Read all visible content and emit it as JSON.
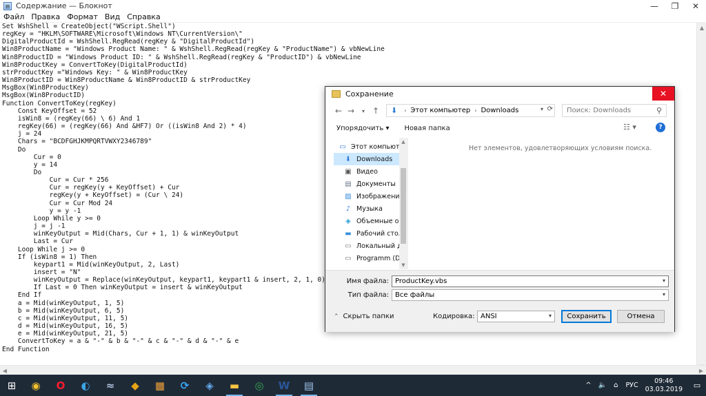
{
  "window": {
    "title": "Содержание — Блокнот",
    "minimize": "—",
    "maximize": "❐",
    "close": "✕"
  },
  "menu": [
    "Файл",
    "Правка",
    "Формат",
    "Вид",
    "Справка"
  ],
  "editor": {
    "lines": [
      "Set WshShell = CreateObject(\"WScript.Shell\")",
      "regKey = \"HKLM\\SOFTWARE\\Microsoft\\Windows NT\\CurrentVersion\\\"",
      "DigitalProductId = WshShell.RegRead(regKey & \"DigitalProductId\")",
      "Win8ProductName = \"Windows Product Name: \" & WshShell.RegRead(regKey & \"ProductName\") & vbNewLine",
      "Win8ProductID = \"Windows Product ID: \" & WshShell.RegRead(regKey & \"ProductID\") & vbNewLine",
      "Win8ProductKey = ConvertToKey(DigitalProductId)",
      "strProductKey =\"Windows Key: \" & Win8ProductKey",
      "Win8ProductID = Win8ProductName & Win8ProductID & strProductKey",
      "MsgBox(Win8ProductKey)",
      "MsgBox(Win8ProductID)",
      "Function ConvertToKey(regKey)",
      "    Const KeyOffset = 52",
      "    isWin8 = (regKey(66) \\ 6) And 1",
      "    regKey(66) = (regKey(66) And &HF7) Or ((isWin8 And 2) * 4)",
      "    j = 24",
      "    Chars = \"BCDFGHJKMPQRTVWXY2346789\"",
      "    Do",
      "        Cur = 0",
      "        y = 14",
      "        Do",
      "            Cur = Cur * 256",
      "            Cur = regKey(y + KeyOffset) + Cur",
      "            regKey(y + KeyOffset) = (Cur \\ 24)",
      "            Cur = Cur Mod 24",
      "            y = y -1",
      "        Loop While y >= 0",
      "        j = j -1",
      "        winKeyOutput = Mid(Chars, Cur + 1, 1) & winKeyOutput",
      "        Last = Cur",
      "    Loop While j >= 0",
      "    If (isWin8 = 1) Then",
      "        keypart1 = Mid(winKeyOutput, 2, Last)",
      "        insert = \"N\"",
      "        winKeyOutput = Replace(winKeyOutput, keypart1, keypart1 & insert, 2, 1, 0)",
      "        If Last = 0 Then winKeyOutput = insert & winKeyOutput",
      "    End If",
      "    a = Mid(winKeyOutput, 1, 5)",
      "    b = Mid(winKeyOutput, 6, 5)",
      "    c = Mid(winKeyOutput, 11, 5)",
      "    d = Mid(winKeyOutput, 16, 5)",
      "    e = Mid(winKeyOutput, 21, 5)",
      "    ConvertToKey = a & \"-\" & b & \"-\" & c & \"-\" & d & \"-\" & e",
      "End Function"
    ]
  },
  "dialog": {
    "title": "Сохранение",
    "close": "✕",
    "address": {
      "root": "Этот компьютер",
      "current": "Downloads"
    },
    "search_placeholder": "Поиск: Downloads",
    "toolbar": {
      "organize": "Упорядочить ▾",
      "new_folder": "Новая папка",
      "help": "?"
    },
    "tree": [
      {
        "label": "Этот компьютер",
        "icon": "computer-icon",
        "selected": false
      },
      {
        "label": "Downloads",
        "icon": "downloads-icon",
        "selected": true
      },
      {
        "label": "Видео",
        "icon": "video-icon",
        "selected": false
      },
      {
        "label": "Документы",
        "icon": "documents-icon",
        "selected": false
      },
      {
        "label": "Изображения",
        "icon": "images-icon",
        "selected": false
      },
      {
        "label": "Музыка",
        "icon": "music-icon",
        "selected": false
      },
      {
        "label": "Объемные объ",
        "icon": "3d-objects-icon",
        "selected": false
      },
      {
        "label": "Рабочий стол",
        "icon": "desktop-icon",
        "selected": false
      },
      {
        "label": "Локальный дис",
        "icon": "local-disk-icon",
        "selected": false
      },
      {
        "label": "Programm (D:)",
        "icon": "drive-icon",
        "selected": false
      }
    ],
    "empty_message": "Нет элементов, удовлетворяющих условиям поиска.",
    "filename_label": "Имя файла:",
    "filename_value": "ProductKey.vbs",
    "filetype_label": "Тип файла:",
    "filetype_value": "Все файлы",
    "hide_folders": "Скрыть папки",
    "encoding_label": "Кодировка:",
    "encoding_value": "ANSI",
    "save_button": "Сохранить",
    "cancel_button": "Отмена"
  },
  "taskbar": {
    "apps": [
      {
        "name": "chrome-style-browser-icon",
        "glyph": "◉",
        "color": "#f2c12e",
        "open": false
      },
      {
        "name": "opera-icon",
        "glyph": "O",
        "color": "#ff1b2d",
        "open": false
      },
      {
        "name": "ccleaner-icon",
        "glyph": "◐",
        "color": "#3aa3e3",
        "open": false
      },
      {
        "name": "wave-app-icon",
        "glyph": "≈",
        "color": "#b0c4de",
        "open": false
      },
      {
        "name": "shield-app-icon",
        "glyph": "◆",
        "color": "#e6a417",
        "open": false
      },
      {
        "name": "photo-app-icon",
        "glyph": "▦",
        "color": "#f2a33a",
        "open": false
      },
      {
        "name": "refresh-app-icon",
        "glyph": "⟳",
        "color": "#37a6f4",
        "open": false
      },
      {
        "name": "store-app-icon",
        "glyph": "◈",
        "color": "#64a8e8",
        "open": false
      },
      {
        "name": "file-explorer-icon",
        "glyph": "▬",
        "color": "#f6c342",
        "open": true
      },
      {
        "name": "chrome-icon",
        "glyph": "◎",
        "color": "#34a853",
        "open": false
      },
      {
        "name": "word-icon",
        "glyph": "W",
        "color": "#2b579a",
        "open": true
      },
      {
        "name": "notepad-icon",
        "glyph": "▤",
        "color": "#9cc3ea",
        "open": true
      }
    ],
    "tray": {
      "chevron": "^",
      "speaker": "🔈",
      "network": "⌂",
      "lang": "РУС",
      "time": "09:46",
      "date": "03.03.2019",
      "notifications": "▭"
    }
  }
}
